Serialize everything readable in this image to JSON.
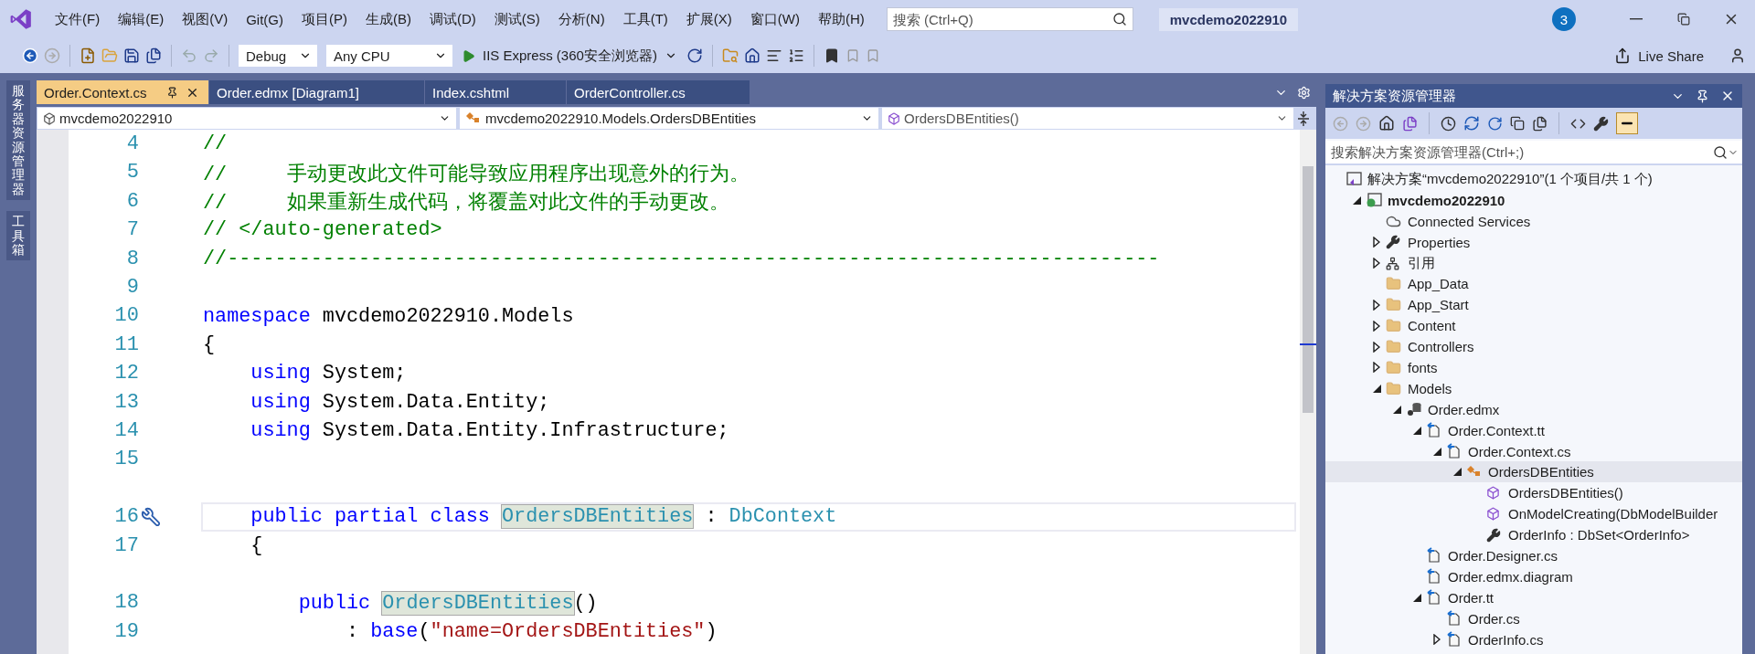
{
  "menu_bar": {
    "items": [
      "文件(F)",
      "编辑(E)",
      "视图(V)",
      "Git(G)",
      "项目(P)",
      "生成(B)",
      "调试(D)",
      "测试(S)",
      "分析(N)",
      "工具(T)",
      "扩展(X)",
      "窗口(W)",
      "帮助(H)"
    ]
  },
  "search": {
    "placeholder": "搜索 (Ctrl+Q)"
  },
  "solution_name": "mvcdemo2022910",
  "notification_count": "3",
  "toolbar": {
    "configuration": "Debug",
    "platform": "Any CPU",
    "run_target": "IIS Express (360安全浏览器)",
    "live_share": "Live Share"
  },
  "side_tabs": [
    "服务器资源管理器",
    "工具箱"
  ],
  "document_tabs": [
    {
      "label": "Order.Context.cs",
      "selected": true
    },
    {
      "label": "Order.edmx [Diagram1]",
      "selected": false
    },
    {
      "label": "Index.cshtml",
      "selected": false
    },
    {
      "label": "OrderController.cs",
      "selected": false
    }
  ],
  "navigation_bar": {
    "project": "mvcdemo2022910",
    "type": "mvcdemo2022910.Models.OrdersDBEntities",
    "member": "OrdersDBEntities()"
  },
  "editor": {
    "lines": [
      {
        "number": "4",
        "codelens_gap": false,
        "current": false,
        "tokens": [
          {
            "kind": "comment",
            "text": "//"
          }
        ]
      },
      {
        "number": "5",
        "codelens_gap": false,
        "current": false,
        "tokens": [
          {
            "kind": "comment",
            "text": "//     手动更改此文件可能导致应用程序出现意外的行为。"
          }
        ]
      },
      {
        "number": "6",
        "codelens_gap": false,
        "current": false,
        "tokens": [
          {
            "kind": "comment",
            "text": "//     如果重新生成代码，将覆盖对此文件的手动更改。"
          }
        ]
      },
      {
        "number": "7",
        "codelens_gap": false,
        "current": false,
        "tokens": [
          {
            "kind": "comment",
            "text": "// </auto-generated>"
          }
        ]
      },
      {
        "number": "8",
        "codelens_gap": false,
        "current": false,
        "tokens": [
          {
            "kind": "comment",
            "text": "//------------------------------------------------------------------------------"
          }
        ]
      },
      {
        "number": "9",
        "codelens_gap": false,
        "current": false
      },
      {
        "number": "10",
        "codelens_gap": false,
        "current": false,
        "tokens": [
          {
            "kind": "keyword",
            "text": "namespace"
          },
          {
            "kind": "plain",
            "text": " mvcdemo2022910.Models"
          }
        ]
      },
      {
        "number": "11",
        "codelens_gap": false,
        "current": false,
        "tokens": [
          {
            "kind": "plain",
            "text": "{"
          }
        ]
      },
      {
        "number": "12",
        "codelens_gap": false,
        "current": false,
        "tokens": [
          {
            "kind": "keyword",
            "text": "    using"
          },
          {
            "kind": "plain",
            "text": " System;"
          }
        ]
      },
      {
        "number": "13",
        "codelens_gap": false,
        "current": false,
        "tokens": [
          {
            "kind": "keyword",
            "text": "    using"
          },
          {
            "kind": "plain",
            "text": " System.Data.Entity;"
          }
        ]
      },
      {
        "number": "14",
        "codelens_gap": false,
        "current": false,
        "tokens": [
          {
            "kind": "keyword",
            "text": "    using"
          },
          {
            "kind": "plain",
            "text": " System.Data.Entity.Infrastructure;"
          }
        ]
      },
      {
        "number": "15",
        "codelens_gap": false,
        "current": false
      },
      {
        "number": "16",
        "codelens_gap": true,
        "current": true,
        "tokens": [
          {
            "kind": "keyword",
            "text": "    public partial class "
          },
          {
            "kind": "reference",
            "text": "OrdersDBEntities"
          },
          {
            "kind": "plain",
            "text": " : "
          },
          {
            "kind": "type",
            "text": "DbContext"
          }
        ]
      },
      {
        "number": "17",
        "codelens_gap": false,
        "current": false,
        "tokens": [
          {
            "kind": "plain",
            "text": "    {"
          }
        ]
      },
      {
        "number": "18",
        "codelens_gap": true,
        "current": false,
        "tokens": [
          {
            "kind": "keyword",
            "text": "        public "
          },
          {
            "kind": "reference",
            "text": "OrdersDBEntities"
          },
          {
            "kind": "plain",
            "text": "()"
          }
        ]
      },
      {
        "number": "19",
        "codelens_gap": false,
        "current": false,
        "tokens": [
          {
            "kind": "plain",
            "text": "            : "
          },
          {
            "kind": "keyword",
            "text": "base"
          },
          {
            "kind": "plain",
            "text": "("
          },
          {
            "kind": "string",
            "text": "\"name=OrdersDBEntities\""
          },
          {
            "kind": "plain",
            "text": ")"
          }
        ]
      }
    ]
  },
  "solution_explorer": {
    "title": "解决方案资源管理器",
    "search": {
      "placeholder": "搜索解决方案资源管理器(Ctrl+;)"
    },
    "tree": [
      {
        "label": "解决方案“mvcdemo2022910”(1 个项目/共 1 个)",
        "kind": "solution",
        "selected": false,
        "children": [
          {
            "label": "mvcdemo2022910",
            "kind": "project",
            "expanded": true,
            "selected": false,
            "children": [
              {
                "label": "Connected Services",
                "kind": "cloud",
                "selected": false
              },
              {
                "label": "Properties",
                "kind": "wrench",
                "expanded": false,
                "selected": false
              },
              {
                "label": "引用",
                "kind": "references",
                "expanded": false,
                "selected": false
              },
              {
                "label": "App_Data",
                "kind": "folder",
                "selected": false
              },
              {
                "label": "App_Start",
                "kind": "folder",
                "expanded": false,
                "selected": false
              },
              {
                "label": "Content",
                "kind": "folder",
                "expanded": false,
                "selected": false
              },
              {
                "label": "Controllers",
                "kind": "folder",
                "expanded": false,
                "selected": false
              },
              {
                "label": "fonts",
                "kind": "folder",
                "expanded": false,
                "selected": false
              },
              {
                "label": "Models",
                "kind": "folder",
                "expanded": true,
                "selected": false,
                "children": [
                  {
                    "label": "Order.edmx",
                    "kind": "model",
                    "expanded": true,
                    "selected": false,
                    "children": [
                      {
                        "label": "Order.Context.tt",
                        "kind": "file",
                        "expanded": true,
                        "selected": false,
                        "children": [
                          {
                            "label": "Order.Context.cs",
                            "kind": "file",
                            "expanded": true,
                            "selected": false,
                            "children": [
                              {
                                "label": "OrdersDBEntities",
                                "kind": "class",
                                "expanded": true,
                                "selected": true,
                                "children": [
                                  {
                                    "label": "OrdersDBEntities()",
                                    "kind": "method",
                                    "selected": false
                                  },
                                  {
                                    "label": "OnModelCreating(DbModelBuilder",
                                    "kind": "method",
                                    "selected": false
                                  },
                                  {
                                    "label": "OrderInfo : DbSet<OrderInfo>",
                                    "kind": "wrench",
                                    "selected": false
                                  }
                                ]
                              }
                            ]
                          }
                        ]
                      },
                      {
                        "label": "Order.Designer.cs",
                        "kind": "file",
                        "selected": false
                      },
                      {
                        "label": "Order.edmx.diagram",
                        "kind": "file",
                        "selected": false
                      },
                      {
                        "label": "Order.tt",
                        "kind": "file",
                        "expanded": true,
                        "selected": false,
                        "children": [
                          {
                            "label": "Order.cs",
                            "kind": "file",
                            "selected": false
                          },
                          {
                            "label": "OrderInfo.cs",
                            "kind": "file",
                            "expanded": false,
                            "selected": false
                          }
                        ]
                      }
                    ]
                  }
                ]
              }
            ]
          }
        ]
      }
    ]
  }
}
